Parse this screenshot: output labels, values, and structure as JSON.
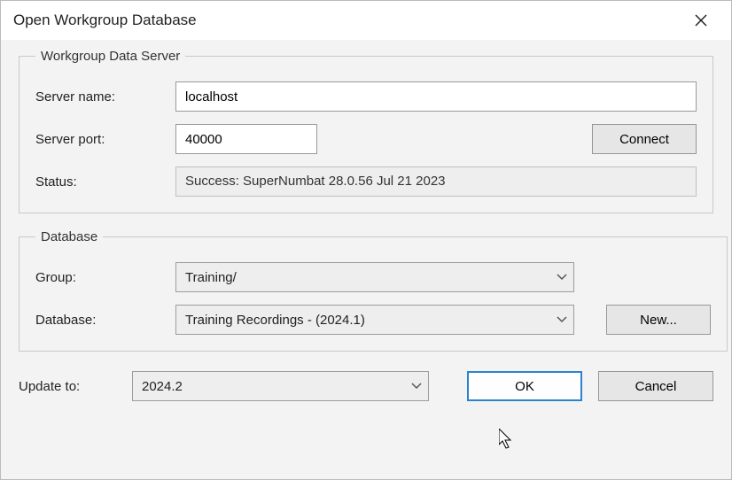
{
  "window": {
    "title": "Open Workgroup Database"
  },
  "server_group": {
    "legend": "Workgroup Data Server",
    "server_name_label": "Server name:",
    "server_name_value": "localhost",
    "server_port_label": "Server port:",
    "server_port_value": "40000",
    "connect_label": "Connect",
    "status_label": "Status:",
    "status_value": "Success: SuperNumbat 28.0.56 Jul 21 2023"
  },
  "database_group": {
    "legend": "Database",
    "group_label": "Group:",
    "group_value": "Training/",
    "database_label": "Database:",
    "database_value": "Training Recordings  - (2024.1)",
    "new_label": "New..."
  },
  "footer": {
    "update_to_label": "Update to:",
    "update_to_value": "2024.2",
    "ok_label": "OK",
    "cancel_label": "Cancel"
  }
}
